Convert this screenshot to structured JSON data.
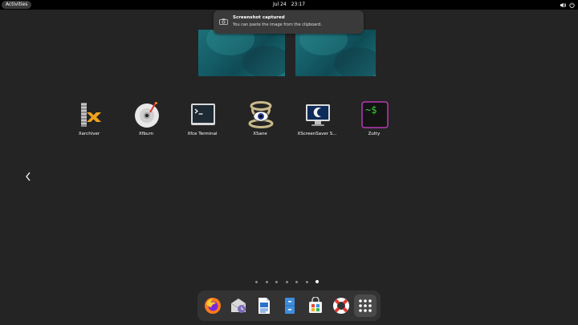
{
  "topbar": {
    "activities_label": "Activities",
    "date": "Jul 24",
    "time": "23:17",
    "icons": [
      "volume-icon",
      "power-icon"
    ]
  },
  "notification": {
    "icon": "screenshot-icon",
    "title": "Screenshot captured",
    "body": "You can paste the image from the clipboard."
  },
  "workspaces": [
    {
      "name": "workspace-1"
    },
    {
      "name": "workspace-2"
    }
  ],
  "apps": [
    {
      "label": "Xarchiver",
      "icon": "xarchiver-icon"
    },
    {
      "label": "Xfburn",
      "icon": "xfburn-icon"
    },
    {
      "label": "Xfce Terminal",
      "icon": "terminal-icon"
    },
    {
      "label": "XSane",
      "icon": "xsane-icon"
    },
    {
      "label": "XScreenSaver S...",
      "icon": "xscreensaver-icon"
    },
    {
      "label": "Zutty",
      "icon": "zutty-icon"
    }
  ],
  "pagination": {
    "pages": 7,
    "current": 7
  },
  "dash": [
    {
      "name": "firefox",
      "icon": "firefox-icon"
    },
    {
      "name": "evolution",
      "icon": "mail-clock-icon"
    },
    {
      "name": "writer",
      "icon": "document-writer-icon"
    },
    {
      "name": "file-manager",
      "icon": "file-cabinet-icon"
    },
    {
      "name": "software",
      "icon": "software-bag-icon"
    },
    {
      "name": "help",
      "icon": "lifebuoy-icon"
    },
    {
      "name": "show-apps",
      "icon": "app-grid-icon"
    }
  ],
  "colors": {
    "background": "#242424",
    "topbar": "#000000",
    "notification_bg": "#3a3a3a",
    "dash_bg": "#333333",
    "wallpaper_teal": "#1d6f78"
  }
}
